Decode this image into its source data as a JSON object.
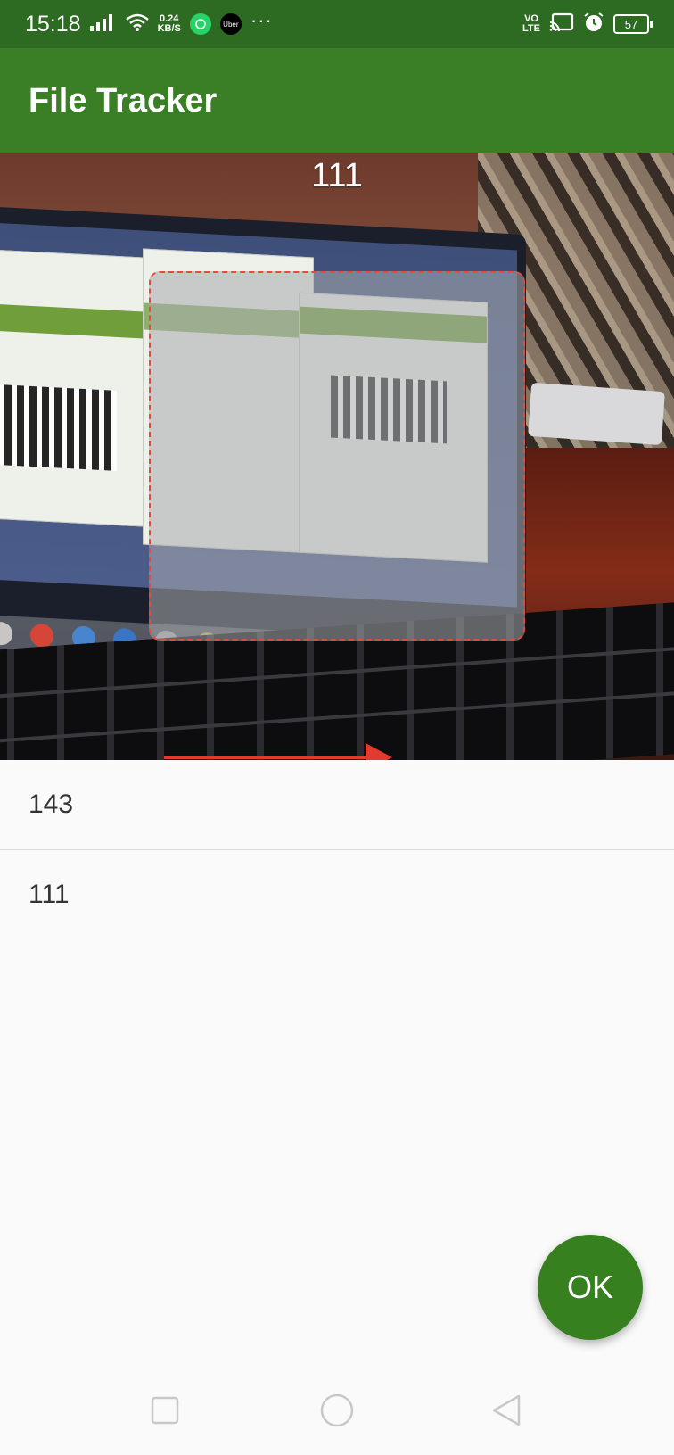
{
  "status_bar": {
    "time": "15:18",
    "network_speed_value": "0.24",
    "network_speed_unit": "KB/S",
    "volte_top": "VO",
    "volte_bottom": "LTE",
    "battery": "57",
    "uber_label": "Uber",
    "more": "···"
  },
  "app_bar": {
    "title": "File Tracker"
  },
  "scanner": {
    "detected_value": "111"
  },
  "list": {
    "items": [
      "143",
      "111"
    ]
  },
  "fab": {
    "label": "OK"
  },
  "colors": {
    "status_bar": "#2d6a22",
    "app_bar": "#3a7f26",
    "fab": "#37801f",
    "scan_frame": "#e64a3c"
  }
}
